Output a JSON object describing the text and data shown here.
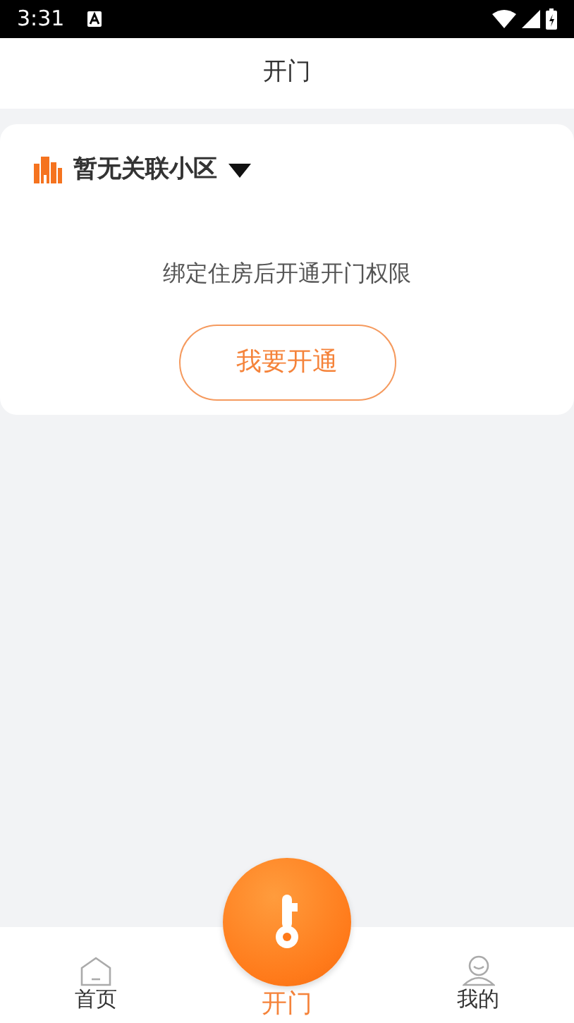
{
  "status_bar": {
    "time": "3:31"
  },
  "header": {
    "title": "开门"
  },
  "community": {
    "name": "暂无关联小区"
  },
  "message": "绑定住房后开通开门权限",
  "open_button": "我要开通",
  "tabs": [
    {
      "label": "首页",
      "kind": "home",
      "selected": false
    },
    {
      "label": "开门",
      "kind": "key",
      "selected": true
    },
    {
      "label": "我的",
      "kind": "profile",
      "selected": false
    }
  ]
}
